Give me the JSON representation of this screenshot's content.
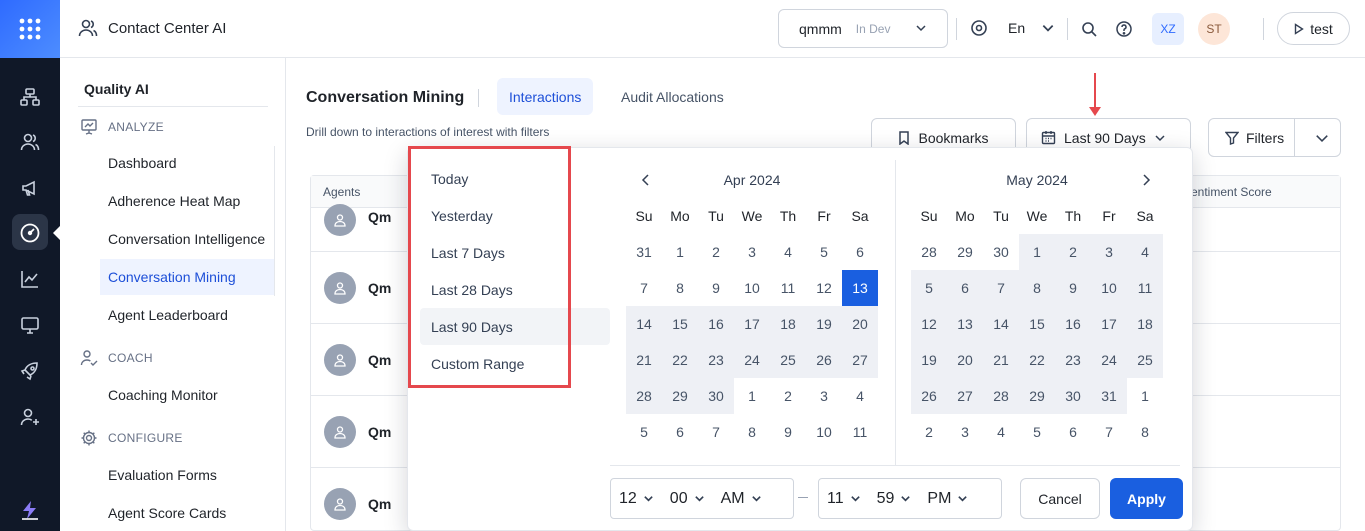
{
  "topbar": {
    "app_title": "Contact Center AI",
    "env_name": "qmmm",
    "env_status": "In Dev",
    "language": "En",
    "avatar_1": "XZ",
    "avatar_2": "ST",
    "test_label": "test"
  },
  "sidebar": {
    "title": "Quality AI",
    "sections": {
      "analyze": "ANALYZE",
      "coach": "COACH",
      "configure": "CONFIGURE"
    },
    "items": [
      {
        "label": "Dashboard"
      },
      {
        "label": "Adherence Heat Map"
      },
      {
        "label": "Conversation Intelligence"
      },
      {
        "label": "Conversation Mining"
      },
      {
        "label": "Agent Leaderboard"
      },
      {
        "label": "Coaching Monitor"
      },
      {
        "label": "Evaluation Forms"
      },
      {
        "label": "Agent Score Cards"
      }
    ]
  },
  "main": {
    "title": "Conversation Mining",
    "tabs": [
      {
        "label": "Interactions"
      },
      {
        "label": "Audit Allocations"
      }
    ],
    "subtitle": "Drill down to interactions of interest with filters",
    "bookmarks_label": "Bookmarks",
    "date_range_label": "Last 90 Days",
    "filters_label": "Filters"
  },
  "table": {
    "col_agents": "Agents",
    "col_sentiment": "entiment Score",
    "rows": [
      {
        "name": "Qm"
      },
      {
        "name": "Qm"
      },
      {
        "name": "Qm"
      },
      {
        "name": "Qm"
      },
      {
        "name": "Qm"
      }
    ]
  },
  "picker": {
    "presets": [
      "Today",
      "Yesterday",
      "Last 7 Days",
      "Last 28 Days",
      "Last 90 Days",
      "Custom Range"
    ],
    "selected_preset": "Last 90 Days",
    "weekdays": [
      "Su",
      "Mo",
      "Tu",
      "We",
      "Th",
      "Fr",
      "Sa"
    ],
    "left_month": {
      "label": "Apr 2024",
      "weeks": [
        [
          "31",
          "1",
          "2",
          "3",
          "4",
          "5",
          "6"
        ],
        [
          "7",
          "8",
          "9",
          "10",
          "11",
          "12",
          "13"
        ],
        [
          "14",
          "15",
          "16",
          "17",
          "18",
          "19",
          "20"
        ],
        [
          "21",
          "22",
          "23",
          "24",
          "25",
          "26",
          "27"
        ],
        [
          "28",
          "29",
          "30",
          "1",
          "2",
          "3",
          "4"
        ],
        [
          "5",
          "6",
          "7",
          "8",
          "9",
          "10",
          "11"
        ]
      ]
    },
    "right_month": {
      "label": "May 2024",
      "weeks": [
        [
          "28",
          "29",
          "30",
          "1",
          "2",
          "3",
          "4"
        ],
        [
          "5",
          "6",
          "7",
          "8",
          "9",
          "10",
          "11"
        ],
        [
          "12",
          "13",
          "14",
          "15",
          "16",
          "17",
          "18"
        ],
        [
          "19",
          "20",
          "21",
          "22",
          "23",
          "24",
          "25"
        ],
        [
          "26",
          "27",
          "28",
          "29",
          "30",
          "31",
          "1"
        ],
        [
          "2",
          "3",
          "4",
          "5",
          "6",
          "7",
          "8"
        ]
      ]
    },
    "start_time": {
      "hour": "12",
      "minute": "00",
      "ampm": "AM"
    },
    "end_time": {
      "hour": "11",
      "minute": "59",
      "ampm": "PM"
    },
    "cancel_label": "Cancel",
    "apply_label": "Apply",
    "colors": {
      "accent": "#1a5fe0",
      "range_bg": "#eef0f5",
      "highlight": "#e5484d"
    }
  }
}
